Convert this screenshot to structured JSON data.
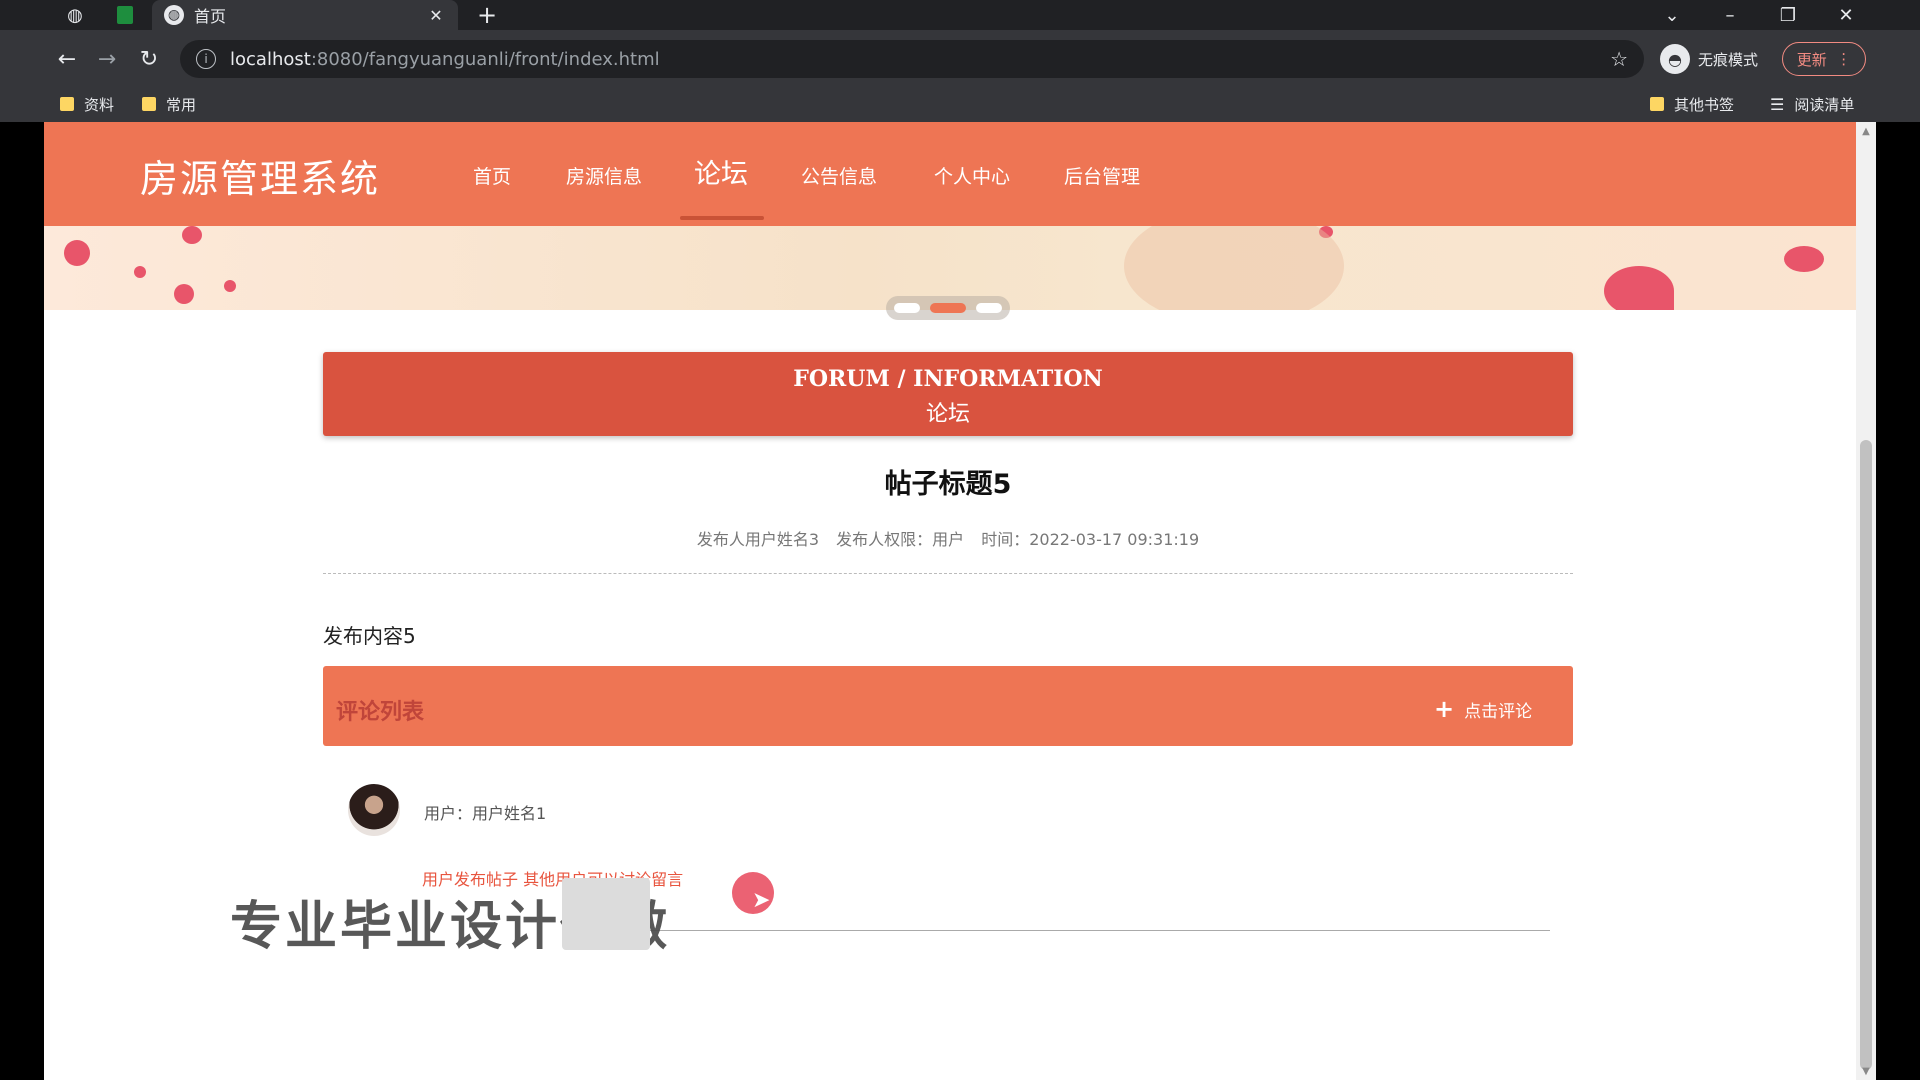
{
  "browser": {
    "tab_title": "首页",
    "tab_close": "✕",
    "new_tab": "+",
    "url_host": "localhost",
    "url_rest": ":8080/fangyuanguanli/front/index.html",
    "incognito_label": "无痕模式",
    "update_label": "更新",
    "bookmarks": [
      "资料",
      "常用"
    ],
    "other_bookmarks": "其他书签",
    "reading_list": "阅读清单"
  },
  "site": {
    "logo": "房源管理系统",
    "nav": [
      "首页",
      "房源信息",
      "论坛",
      "公告信息",
      "个人中心",
      "后台管理"
    ],
    "active_nav": "论坛"
  },
  "forum_header": {
    "en": "FORUM / INFORMATION",
    "cn": "论坛"
  },
  "post": {
    "title": "帖子标题5",
    "author": "发布人用户姓名3",
    "role": "发布人权限：用户",
    "time": "时间：2022-03-17 09:31:19",
    "content": "发布内容5"
  },
  "comments": {
    "title": "评论列表",
    "add_button": "点击评论",
    "items": [
      {
        "user": "用户：用户姓名1",
        "text": "用户发布帖子 其他用户可以讨论留言"
      }
    ]
  },
  "overlay": {
    "watermark": "专业毕业设计代做"
  },
  "colors": {
    "primary": "#ee7554",
    "header": "#d9533f",
    "accent_text": "#e8553f"
  }
}
